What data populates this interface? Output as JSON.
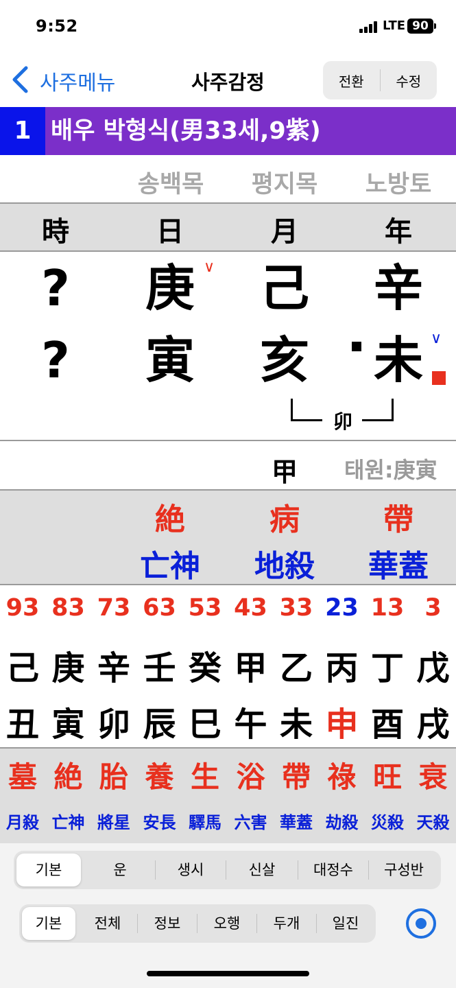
{
  "status": {
    "time": "9:52",
    "network": "LTE",
    "battery": "90"
  },
  "nav": {
    "back_label": "사주메뉴",
    "title": "사주감정",
    "buttons": [
      "전환",
      "수정"
    ]
  },
  "profile": {
    "number": "1",
    "title": "배우 박형식(男33세,9紫)"
  },
  "nayin": [
    "송백목",
    "평지목",
    "노방토"
  ],
  "pillar_headers": [
    "時",
    "日",
    "月",
    "年"
  ],
  "stems": [
    "?",
    "庚",
    "己",
    "辛"
  ],
  "branches": [
    "?",
    "寅",
    "亥",
    "未"
  ],
  "check_mark": "∨",
  "combination": "卯",
  "hidden_stem": "甲",
  "taewon": "태원:庚寅",
  "twelve_stages": [
    "絶",
    "病",
    "帶"
  ],
  "twelve_sinsal": [
    "亡神",
    "地殺",
    "華蓋"
  ],
  "daewoon": {
    "ages": [
      "93",
      "83",
      "73",
      "63",
      "53",
      "43",
      "33",
      "23",
      "13",
      "3"
    ],
    "stems": [
      "己",
      "庚",
      "辛",
      "壬",
      "癸",
      "甲",
      "乙",
      "丙",
      "丁",
      "戊"
    ],
    "branches": [
      "丑",
      "寅",
      "卯",
      "辰",
      "巳",
      "午",
      "未",
      "申",
      "酉",
      "戌"
    ],
    "stages": [
      "墓",
      "絶",
      "胎",
      "養",
      "生",
      "浴",
      "帶",
      "祿",
      "旺",
      "衰"
    ],
    "sinsal": [
      "月殺",
      "亡神",
      "將星",
      "安長",
      "驛馬",
      "六害",
      "華蓋",
      "劫殺",
      "災殺",
      "天殺"
    ],
    "highlight_index": 7
  },
  "tabs_main": [
    "기본",
    "운",
    "생시",
    "신살",
    "대정수",
    "구성반"
  ],
  "tabs_sub": [
    "기본",
    "전체",
    "정보",
    "오행",
    "두개",
    "일진"
  ],
  "colors": {
    "accent_blue": "#1e6fe0",
    "purple": "#7b2fc9",
    "red": "#e8301e",
    "blue": "#0a20d8",
    "gray": "#a8a8a8"
  }
}
